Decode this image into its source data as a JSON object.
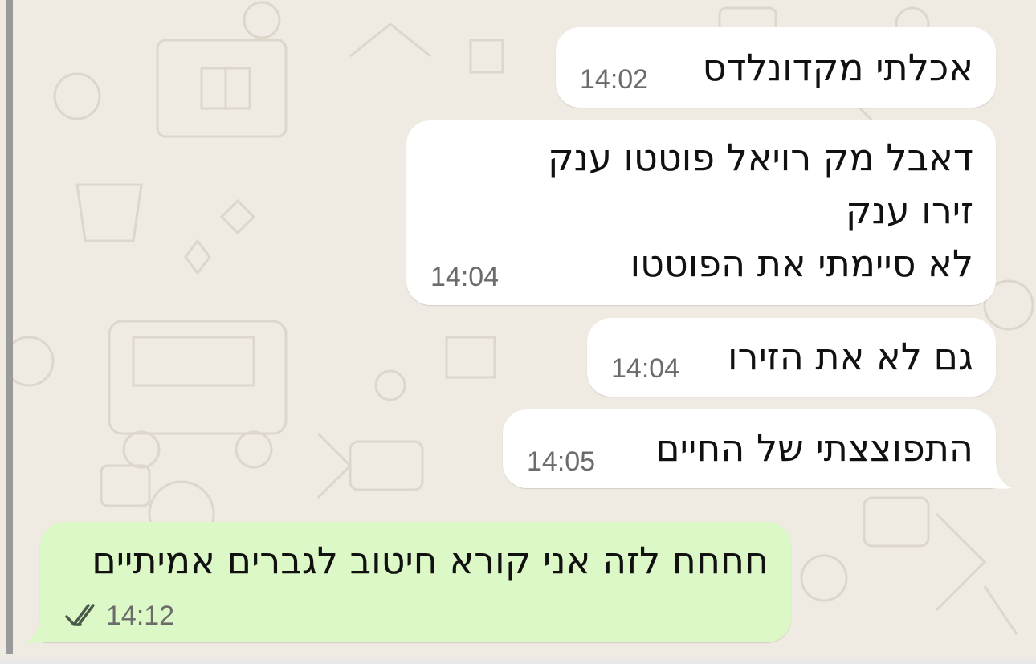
{
  "chat": {
    "messages": [
      {
        "direction": "incoming",
        "lines": [
          "אכלתי מקדונלדס"
        ],
        "time": "14:02"
      },
      {
        "direction": "incoming",
        "lines": [
          "דאבל מק רויאל פוטטו ענק",
          "זירו ענק",
          "לא סיימתי את הפוטטו"
        ],
        "time": "14:04"
      },
      {
        "direction": "incoming",
        "lines": [
          "גם לא את הזירו"
        ],
        "time": "14:04"
      },
      {
        "direction": "incoming",
        "lines": [
          "התפוצצתי של החיים"
        ],
        "time": "14:05"
      },
      {
        "direction": "outgoing",
        "lines": [
          "חחחח לזה אני קורא חיטוב לגברים אמיתיים"
        ],
        "time": "14:12",
        "status_icon": "double-check-icon"
      }
    ]
  },
  "colors": {
    "wallpaper": "#efeae2",
    "incoming_bubble": "#ffffff",
    "outgoing_bubble": "#dcf8c6",
    "timestamp": "#6b6b6b"
  }
}
